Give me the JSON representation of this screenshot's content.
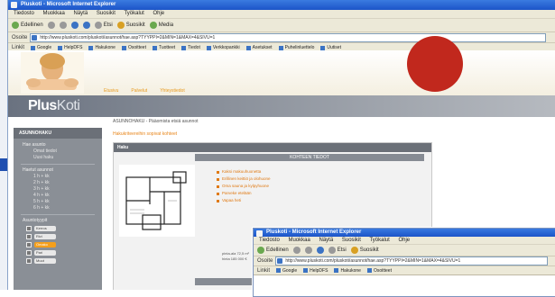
{
  "window": {
    "title": "Pluskoti - Microsoft Internet Explorer",
    "menu": [
      "Tiedosto",
      "Muokkaa",
      "Näytä",
      "Suosikit",
      "Työkalut",
      "Ohje"
    ],
    "toolbar": [
      {
        "label": "Edellinen",
        "icon": "back-arrow-icon"
      },
      {
        "label": "",
        "icon": "forward-arrow-icon"
      },
      {
        "label": "",
        "icon": "stop-icon"
      },
      {
        "label": "",
        "icon": "refresh-icon"
      },
      {
        "label": "",
        "icon": "home-icon"
      },
      {
        "label": "Etsi",
        "icon": "search-icon"
      },
      {
        "label": "Suosikit",
        "icon": "favorites-star-icon"
      },
      {
        "label": "Media",
        "icon": "media-icon"
      }
    ],
    "address_label": "Osoite",
    "address": "http://www.pluskoti.com/pluskoti/asunnot/hae.asp?TYYPPI=2&MIN=1&MAX=4&SIVU=1",
    "links_label": "Linkit",
    "links": [
      "Google",
      "HelpDFS",
      "Hakukone",
      "Osoitteet",
      "Tuotteet",
      "Tiedot",
      "Verkkopankki",
      "Asetukset",
      "Puhelinluettelo",
      "Uutiset"
    ]
  },
  "site": {
    "nav": [
      "Etusivu",
      "Palvelut",
      "Yhteystiedot"
    ],
    "logo_text": "Plus",
    "logo_light": "Koti",
    "breadcrumb": "ASUNNOHAKU - Pääomista etsiä asunnot",
    "page_title": "Hakukriteereihin sopivat kohteet",
    "sidebar_title": "ASUNNOHAKU",
    "sidebar_items": [
      "Hae asunto",
      "Omat tiedot",
      "Uusi haku",
      "Haetut asunnot"
    ],
    "sidebar_subitems": [
      "1 h + kk",
      "2 h + kk",
      "3 h + kk",
      "4 h + kk",
      "5 h + kk",
      "6 h + kk"
    ],
    "sidebar_section2": "Asuntotyypit",
    "sidebar_checks": [
      {
        "label": "Kerros",
        "active": false
      },
      {
        "label": "Rivi",
        "active": false
      },
      {
        "label": "Omako",
        "active": true
      },
      {
        "label": "Pari",
        "active": false
      },
      {
        "label": "Muut",
        "active": false
      }
    ],
    "panel_title": "Haku",
    "panel_subtitle": "KOHTEEN TIEDOT",
    "features": [
      "Kaksi makuuhuonetta",
      "Erillinen keittiö ja olohuone",
      "Oma sauna ja kylpyhuone",
      "Parveke etelään",
      "Vapaa heti"
    ],
    "details": [
      "pinta-ala  72,5 m²",
      "hinta  185 000 €"
    ],
    "panel_bottom": "KOHTEEN TIEDOT",
    "colors": {
      "accent": "#e8851a",
      "sidebar": "#8a8f96",
      "brand_bar": "#7a808a",
      "marker": "#c1281d"
    }
  }
}
